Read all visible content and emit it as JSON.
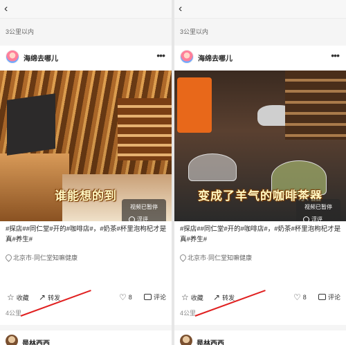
{
  "back_glyph": "‹",
  "filter_text": "3公里以内",
  "post": {
    "author": "海绵去哪儿",
    "more_glyph": "•••",
    "tags": "#探店##同仁堂#开的#咖啡店#，#奶茶#杯里泡枸杞才是真#养生#",
    "location": "北京市·同仁堂知嘛健康",
    "paused_label": "视频已暂停",
    "float_label": "浮评",
    "collect_label": "收藏",
    "share_label": "转发",
    "like_count": "8",
    "comment_label": "评论",
    "distance": "4公里"
  },
  "captions": {
    "left": "谁能想的到",
    "right": "变成了羊气的咖啡茶器"
  },
  "next_post": {
    "author": "是林西西"
  },
  "icons": {
    "back": "chevron-left-icon",
    "more": "more-dots-icon",
    "location": "pin-icon",
    "collect": "star-icon",
    "share": "share-arrow-icon",
    "like": "heart-icon",
    "comment": "comment-icon",
    "float": "circle-icon"
  },
  "colors": {
    "annotation": "#e02020",
    "caption_text": "#fff7c2",
    "caption_outline": "#7a3b00"
  }
}
